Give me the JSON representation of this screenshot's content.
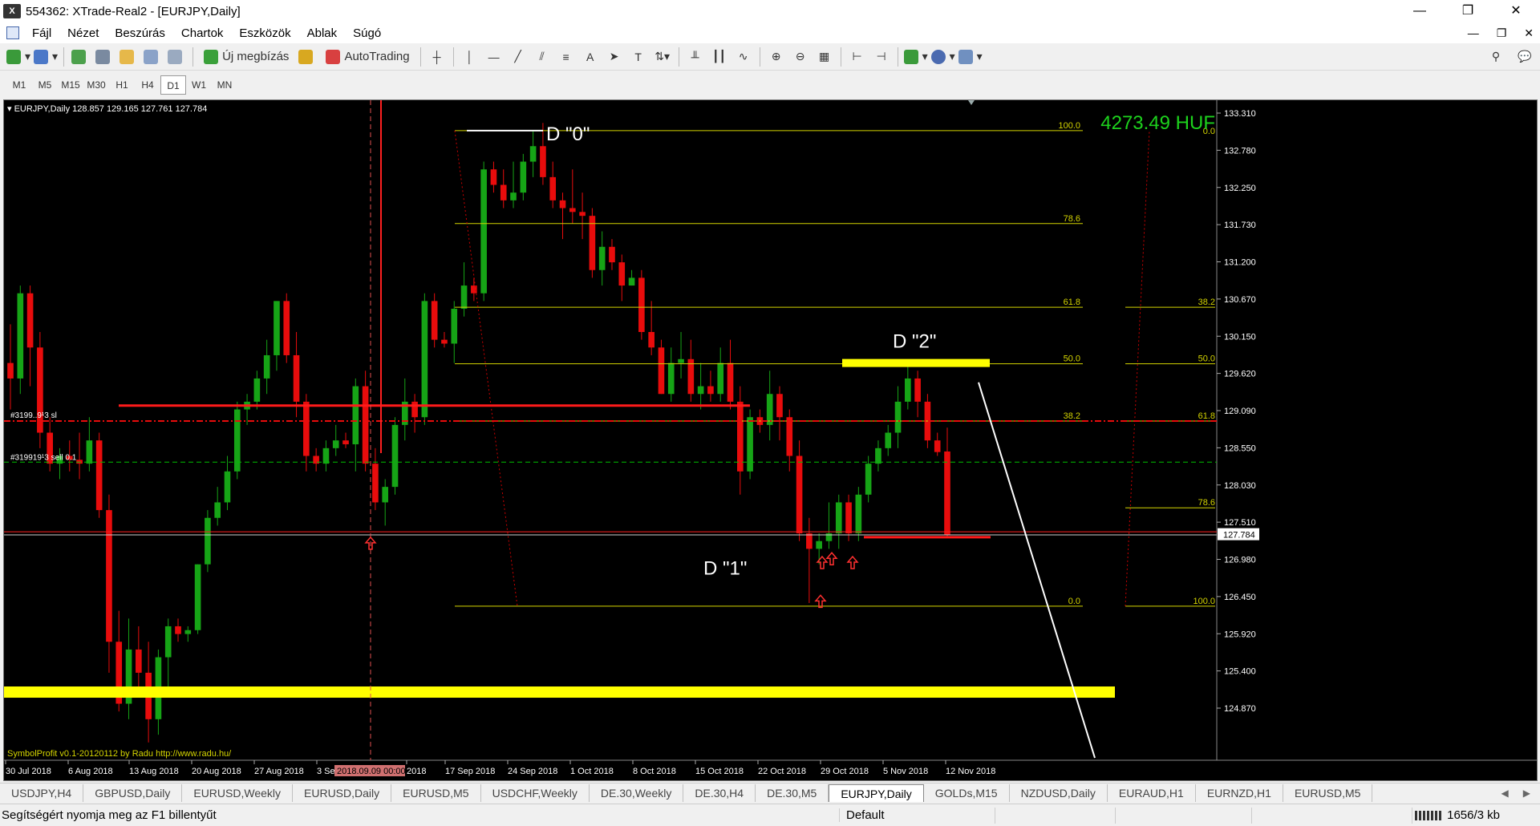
{
  "window": {
    "title": "554362: XTrade-Real2 - [EURJPY,Daily]",
    "controls": [
      "—",
      "❐",
      "✕"
    ]
  },
  "menu": {
    "items": [
      "Fájl",
      "Nézet",
      "Beszúrás",
      "Chartok",
      "Eszközök",
      "Ablak",
      "Súgó"
    ],
    "mdi_controls": [
      "—",
      "❐",
      "✕"
    ]
  },
  "toolbar": {
    "new_order": "Új megbízás",
    "autotrading": "AutoTrading"
  },
  "timeframes": {
    "items": [
      "M1",
      "M5",
      "M15",
      "M30",
      "H1",
      "H4",
      "D1",
      "W1",
      "MN"
    ],
    "active": "D1"
  },
  "chart": {
    "header": "EURJPY,Daily  128.857 129.165 127.761 127.784",
    "account_value": "4273.49 HUF",
    "footer_note": "SymbolProfit v0.1-20120112 by Radu http://www.radu.hu/",
    "order_label_1": "#3199..9¹3 sl",
    "order_label_2": "#319919¹3 sell 0.1",
    "current_price": "127.784",
    "crosshair_date": "2018.09.09 00:00",
    "annotations": {
      "d0": "D \"0\"",
      "d1": "D \"1\"",
      "d2": "D \"2\""
    },
    "price_axis": [
      "133.310",
      "132.780",
      "132.250",
      "131.730",
      "131.200",
      "130.670",
      "130.150",
      "129.620",
      "129.090",
      "128.550",
      "128.030",
      "127.510",
      "126.980",
      "126.450",
      "125.920",
      "125.400",
      "124.870"
    ],
    "date_axis": [
      "30 Jul 2018",
      "6 Aug 2018",
      "13 Aug 2018",
      "20 Aug 2018",
      "27 Aug 2018",
      "3 Se",
      "2018",
      "17 Sep 2018",
      "24 Sep 2018",
      "1 Oct 2018",
      "8 Oct 2018",
      "15 Oct 2018",
      "22 Oct 2018",
      "29 Oct 2018",
      "5 Nov 2018",
      "12 Nov 2018"
    ],
    "fib_left_labels": [
      "100.0",
      "78.6",
      "61.8",
      "50.0",
      "38.2",
      "0.0"
    ],
    "fib_right_labels": [
      "0.0",
      "38.2",
      "50.0",
      "61.8",
      "78.6",
      "100.0"
    ],
    "colors": {
      "bull": "#16a416",
      "bear": "#e80c0c",
      "fib": "#d4d400",
      "zone": "#ffff00",
      "account": "#1dd21d"
    }
  },
  "chart_data": {
    "type": "candlestick",
    "symbol": "EURJPY",
    "timeframe": "Daily",
    "ohlc_last": {
      "open": 128.857,
      "high": 129.165,
      "low": 127.761,
      "close": 127.784
    },
    "ylim": [
      124.87,
      133.31
    ],
    "fib_levels_left": [
      {
        "level": "100.0",
        "price": 133.0
      },
      {
        "level": "78.6",
        "price": 131.8
      },
      {
        "level": "61.8",
        "price": 130.72
      },
      {
        "level": "50.0",
        "price": 129.99
      },
      {
        "level": "38.2",
        "price": 129.25
      },
      {
        "level": "0.0",
        "price": 126.86
      }
    ],
    "fib_levels_right": [
      {
        "level": "0.0",
        "price": 133.0
      },
      {
        "level": "38.2",
        "price": 130.72
      },
      {
        "level": "50.0",
        "price": 129.99
      },
      {
        "level": "61.8",
        "price": 129.25
      },
      {
        "level": "78.6",
        "price": 128.13
      },
      {
        "level": "100.0",
        "price": 126.86
      }
    ],
    "horizontal_lines": [
      {
        "name": "sl-line",
        "price": 129.25,
        "color": "#e80c0c",
        "style": "dashdot"
      },
      {
        "name": "sell-line",
        "price": 128.72,
        "color": "#00c000",
        "style": "dashed"
      },
      {
        "name": "bid-line",
        "price": 127.78,
        "color": "#d0d0d0",
        "style": "solid"
      }
    ],
    "candles": [
      [
        130.0,
        130.5,
        129.4,
        129.8
      ],
      [
        129.8,
        131.0,
        129.6,
        130.9
      ],
      [
        130.9,
        131.0,
        129.7,
        130.2
      ],
      [
        130.2,
        130.4,
        128.9,
        129.1
      ],
      [
        129.1,
        129.3,
        128.6,
        128.7
      ],
      [
        128.7,
        128.9,
        128.5,
        128.8
      ],
      [
        128.8,
        129.0,
        128.6,
        128.75
      ],
      [
        128.75,
        129.1,
        128.5,
        128.7
      ],
      [
        128.7,
        129.3,
        128.6,
        129.0
      ],
      [
        129.0,
        129.1,
        128.0,
        128.1
      ],
      [
        128.1,
        128.3,
        126.0,
        126.4
      ],
      [
        126.4,
        126.8,
        125.5,
        125.6
      ],
      [
        125.6,
        126.7,
        125.4,
        126.3
      ],
      [
        126.3,
        126.6,
        125.7,
        126.0
      ],
      [
        126.0,
        126.4,
        125.1,
        125.4
      ],
      [
        125.4,
        126.3,
        125.2,
        126.2
      ],
      [
        126.2,
        126.7,
        125.8,
        126.6
      ],
      [
        126.6,
        126.7,
        126.4,
        126.5
      ],
      [
        126.5,
        126.6,
        126.4,
        126.55
      ],
      [
        126.55,
        127.4,
        126.5,
        127.4
      ],
      [
        127.4,
        128.1,
        127.3,
        128.0
      ],
      [
        128.0,
        128.4,
        127.9,
        128.2
      ],
      [
        128.2,
        128.8,
        128.1,
        128.6
      ],
      [
        128.6,
        129.5,
        128.5,
        129.4
      ],
      [
        129.4,
        129.6,
        129.2,
        129.5
      ],
      [
        129.5,
        129.9,
        129.4,
        129.8
      ],
      [
        129.8,
        130.3,
        129.6,
        130.1
      ],
      [
        130.1,
        130.8,
        129.9,
        130.8
      ],
      [
        130.8,
        130.9,
        130.0,
        130.1
      ],
      [
        130.1,
        130.4,
        129.3,
        129.5
      ],
      [
        129.5,
        129.6,
        128.6,
        128.8
      ],
      [
        128.8,
        128.9,
        128.6,
        128.7
      ],
      [
        128.7,
        129.0,
        128.6,
        128.9
      ],
      [
        128.9,
        129.2,
        128.8,
        129.0
      ],
      [
        129.0,
        129.1,
        128.9,
        128.95
      ],
      [
        128.95,
        129.8,
        128.6,
        129.7
      ],
      [
        129.7,
        129.9,
        128.6,
        128.7
      ],
      [
        128.7,
        128.9,
        128.1,
        128.2
      ],
      [
        128.2,
        128.5,
        127.9,
        128.4
      ],
      [
        128.4,
        129.3,
        128.3,
        129.2
      ],
      [
        129.2,
        129.8,
        129.0,
        129.5
      ],
      [
        129.5,
        129.6,
        129.1,
        129.3
      ],
      [
        129.3,
        130.9,
        129.2,
        130.8
      ],
      [
        130.8,
        130.9,
        130.2,
        130.3
      ],
      [
        130.3,
        130.4,
        130.2,
        130.25
      ],
      [
        130.25,
        130.8,
        130.0,
        130.7
      ],
      [
        130.7,
        131.3,
        130.6,
        131.0
      ],
      [
        131.0,
        131.1,
        130.8,
        130.9
      ],
      [
        130.9,
        132.6,
        130.8,
        132.5
      ],
      [
        132.5,
        132.6,
        132.2,
        132.3
      ],
      [
        132.3,
        132.5,
        132.0,
        132.1
      ],
      [
        132.1,
        132.6,
        132.0,
        132.2
      ],
      [
        132.2,
        132.7,
        132.1,
        132.6
      ],
      [
        132.6,
        133.0,
        132.4,
        132.8
      ],
      [
        132.8,
        133.1,
        132.3,
        132.4
      ],
      [
        132.4,
        132.6,
        132.0,
        132.1
      ],
      [
        132.1,
        132.2,
        131.6,
        132.0
      ],
      [
        132.0,
        132.5,
        131.8,
        131.95
      ],
      [
        131.95,
        132.2,
        131.6,
        131.9
      ],
      [
        131.9,
        132.0,
        131.1,
        131.2
      ],
      [
        131.2,
        131.7,
        131.0,
        131.5
      ],
      [
        131.5,
        131.6,
        131.2,
        131.3
      ],
      [
        131.3,
        131.4,
        130.8,
        131.0
      ],
      [
        131.0,
        131.2,
        131.0,
        131.1
      ],
      [
        131.1,
        131.2,
        130.3,
        130.4
      ],
      [
        130.4,
        130.8,
        130.1,
        130.2
      ],
      [
        130.2,
        130.3,
        129.6,
        129.6
      ],
      [
        129.6,
        130.2,
        129.5,
        130.0
      ],
      [
        130.0,
        130.4,
        129.8,
        130.05
      ],
      [
        130.05,
        130.3,
        129.5,
        129.6
      ],
      [
        129.6,
        130.0,
        129.4,
        129.7
      ],
      [
        129.7,
        129.9,
        129.5,
        129.6
      ],
      [
        129.6,
        130.2,
        129.5,
        130.0
      ],
      [
        130.0,
        130.3,
        129.4,
        129.5
      ],
      [
        129.5,
        129.7,
        128.3,
        128.6
      ],
      [
        128.6,
        129.4,
        128.5,
        129.3
      ],
      [
        129.3,
        129.4,
        129.1,
        129.2
      ],
      [
        129.2,
        129.9,
        129.0,
        129.6
      ],
      [
        129.6,
        129.7,
        129.0,
        129.3
      ],
      [
        129.3,
        129.4,
        128.6,
        128.8
      ],
      [
        128.8,
        129.0,
        127.7,
        127.8
      ],
      [
        127.8,
        128.0,
        126.9,
        127.6
      ],
      [
        127.6,
        127.8,
        127.4,
        127.7
      ],
      [
        127.7,
        128.2,
        127.6,
        127.8
      ],
      [
        127.8,
        128.3,
        127.6,
        128.2
      ],
      [
        128.2,
        128.3,
        127.7,
        127.8
      ],
      [
        127.8,
        128.4,
        127.7,
        128.3
      ],
      [
        128.3,
        128.8,
        128.2,
        128.7
      ],
      [
        128.7,
        129.0,
        128.6,
        128.9
      ],
      [
        128.9,
        129.2,
        128.8,
        129.1
      ],
      [
        129.1,
        129.7,
        128.9,
        129.5
      ],
      [
        129.5,
        130.0,
        129.4,
        129.8
      ],
      [
        129.8,
        129.9,
        129.3,
        129.5
      ],
      [
        129.5,
        129.6,
        128.9,
        129.0
      ],
      [
        129.0,
        129.1,
        128.8,
        128.85
      ],
      [
        128.857,
        129.165,
        127.761,
        127.784
      ]
    ]
  },
  "tabs": {
    "items": [
      "USDJPY,H4",
      "GBPUSD,Daily",
      "EURUSD,Weekly",
      "EURUSD,Daily",
      "EURUSD,M5",
      "USDCHF,Weekly",
      "DE.30,Weekly",
      "DE.30,H4",
      "DE.30,M5",
      "EURJPY,Daily",
      "GOLDs,M15",
      "NZDUSD,Daily",
      "EURAUD,H1",
      "EURNZD,H1",
      "EURUSD,M5"
    ],
    "active": "EURJPY,Daily",
    "arrows": [
      "◀",
      "▶"
    ]
  },
  "status": {
    "help": "Segítségért nyomja meg az F1 billentyűt",
    "profile": "Default",
    "traffic": "1656/3 kb"
  }
}
